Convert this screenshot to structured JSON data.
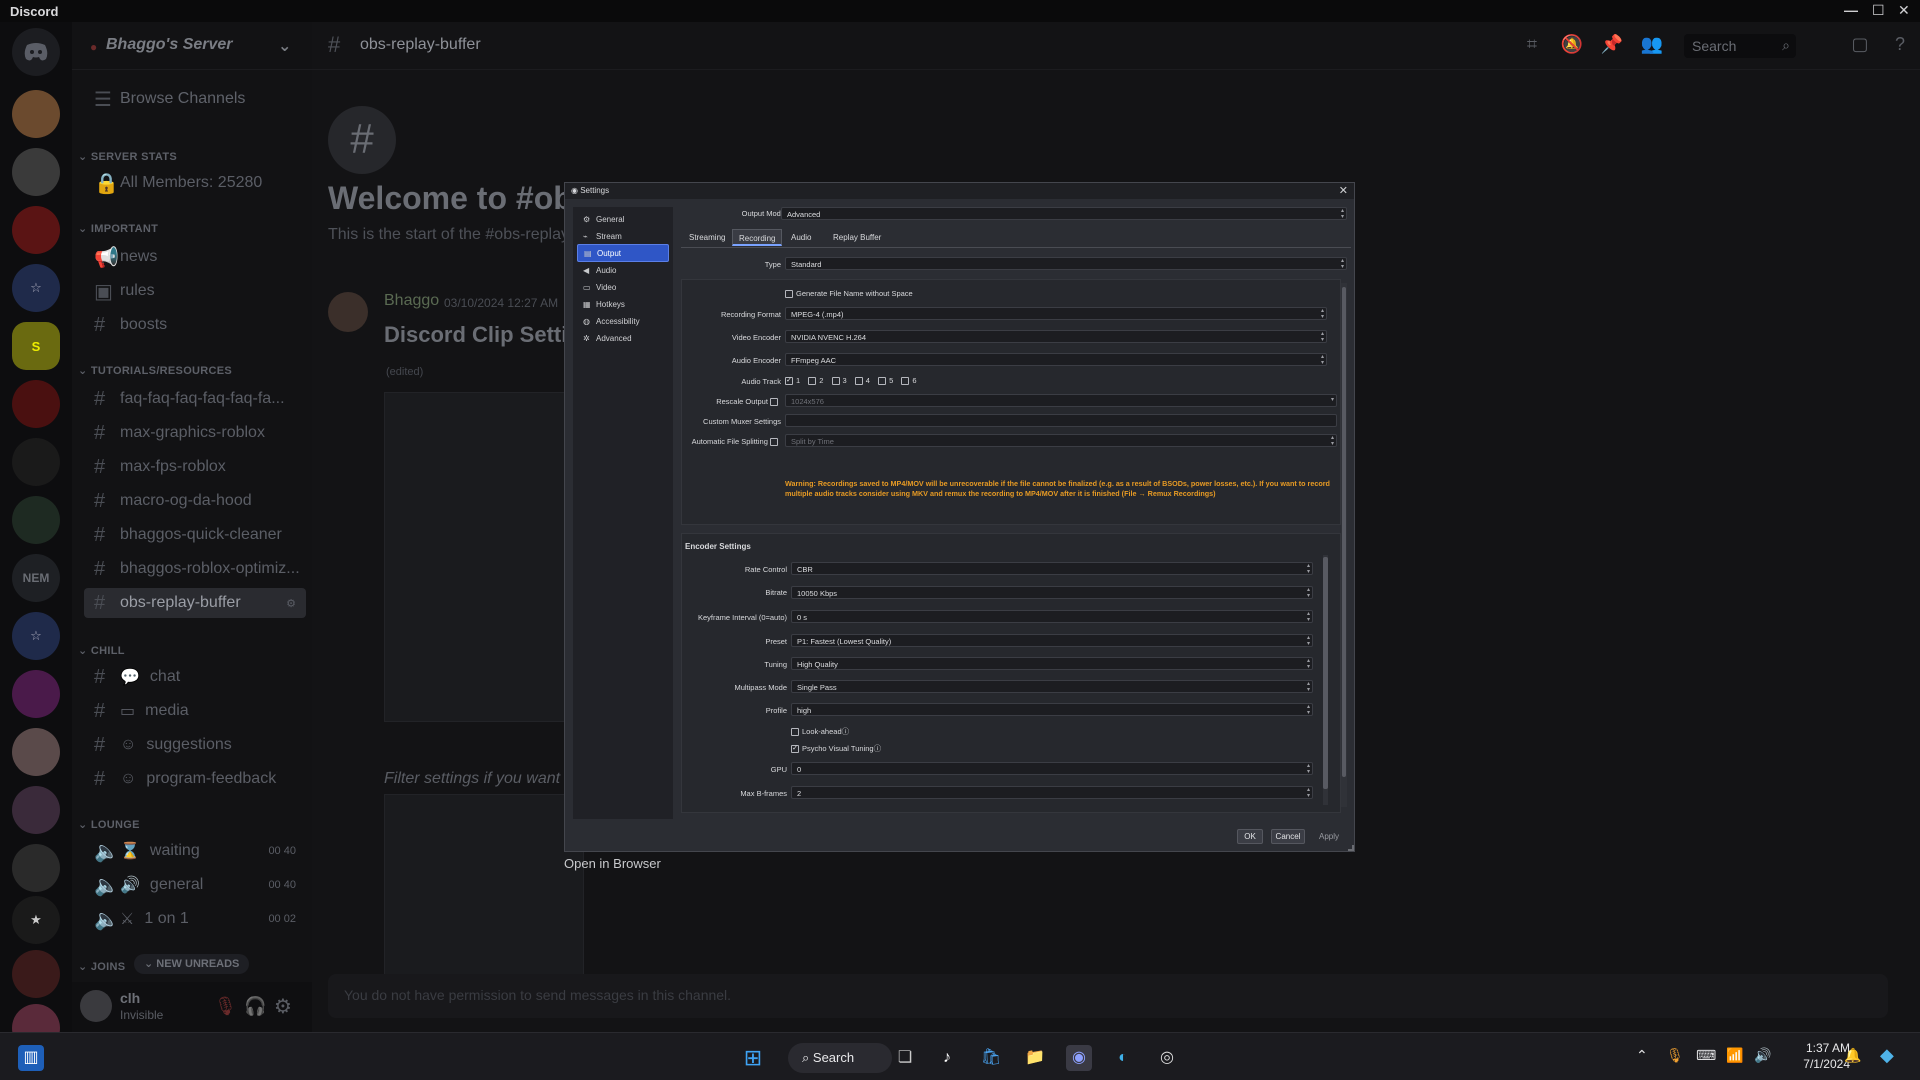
{
  "window": {
    "app_name": "Discord"
  },
  "server": {
    "name": "Bhaggo's Server",
    "browse_label": "Browse Channels"
  },
  "categories": {
    "server_stats": "SERVER STATS",
    "important": "IMPORTANT",
    "tutorials": "TUTORIALS/RESOURCES",
    "chill": "CHILL",
    "lounge": "LOUNGE",
    "joins": "JOINS"
  },
  "channels": {
    "all_members": "All Members: 25280",
    "news": "news",
    "rules": "rules",
    "boosts": "boosts",
    "faq": "faq-faq-faq-faq-faq-fa...",
    "max_graphics": "max-graphics-roblox",
    "max_fps": "max-fps-roblox",
    "macro": "macro-og-da-hood",
    "quick_cleaner": "bhaggos-quick-cleaner",
    "roblox_optimiz": "bhaggos-roblox-optimiz...",
    "obs_replay": "obs-replay-buffer",
    "chat": "chat",
    "media": "media",
    "suggestions": "suggestions",
    "program_feedback": "program-feedback",
    "waiting": "waiting",
    "waiting_cnt_a": "00",
    "waiting_cnt_b": "40",
    "general": "general",
    "general_cnt_a": "00",
    "general_cnt_b": "40",
    "one_on_one": "1 on 1",
    "one_cnt_a": "00",
    "one_cnt_b": "02",
    "new_unreads": "NEW UNREADS"
  },
  "user": {
    "name": "clh",
    "status": "Invisible"
  },
  "topbar": {
    "channel": "obs-replay-buffer",
    "search_placeholder": "Search"
  },
  "chat": {
    "welcome": "Welcome to #obs-",
    "start": "This is the start of the #obs-replay",
    "author": "Bhaggo",
    "timestamp": "03/10/2024 12:27 AM",
    "post_title": "Discord Clip Setti",
    "edited": "(edited)",
    "filter_caption": "Filter settings if you want",
    "open_browser": "Open in Browser",
    "no_permission": "You do not have permission to send messages in this channel."
  },
  "settings": {
    "title": "Settings",
    "nav": [
      {
        "label": "General",
        "icon": "gear-icon"
      },
      {
        "label": "Stream",
        "icon": "broadcast-icon"
      },
      {
        "label": "Output",
        "icon": "output-icon"
      },
      {
        "label": "Audio",
        "icon": "speaker-icon"
      },
      {
        "label": "Video",
        "icon": "monitor-icon"
      },
      {
        "label": "Hotkeys",
        "icon": "keyboard-icon"
      },
      {
        "label": "Accessibility",
        "icon": "accessibility-icon"
      },
      {
        "label": "Advanced",
        "icon": "tools-icon"
      }
    ],
    "output_mode_label": "Output Mode",
    "output_mode": "Advanced",
    "tabs": [
      "Streaming",
      "Recording",
      "Audio",
      "Replay Buffer"
    ],
    "type_label": "Type",
    "type_value": "Standard",
    "gen_filename": "Generate File Name without Space",
    "rec_format_label": "Recording Format",
    "rec_format": "MPEG-4 (.mp4)",
    "video_encoder_label": "Video Encoder",
    "video_encoder": "NVIDIA NVENC H.264",
    "audio_encoder_label": "Audio Encoder",
    "audio_encoder": "FFmpeg AAC",
    "audio_track_label": "Audio Track",
    "tracks": [
      "1",
      "2",
      "3",
      "4",
      "5",
      "6"
    ],
    "rescale_label": "Rescale Output",
    "rescale_value": "1024x576",
    "muxer_label": "Custom Muxer Settings",
    "split_label": "Automatic File Splitting",
    "split_value": "Split by Time",
    "warning": "Warning: Recordings saved to MP4/MOV will be unrecoverable if the file cannot be finalized (e.g. as a result of BSODs, power losses, etc.). If you want to record multiple audio tracks consider using MKV and remux the recording to MP4/MOV after it is finished (File → Remux Recordings)",
    "encoder_settings": "Encoder Settings",
    "rate_control_label": "Rate Control",
    "rate_control": "CBR",
    "bitrate_label": "Bitrate",
    "bitrate": "10050 Kbps",
    "keyframe_label": "Keyframe Interval (0=auto)",
    "keyframe": "0 s",
    "preset_label": "Preset",
    "preset": "P1: Fastest (Lowest Quality)",
    "tuning_label": "Tuning",
    "tuning": "High Quality",
    "multipass_label": "Multipass Mode",
    "multipass": "Single Pass",
    "profile_label": "Profile",
    "profile": "high",
    "lookahead": "Look-ahead",
    "psycho": "Psycho Visual Tuning",
    "gpu_label": "GPU",
    "gpu": "0",
    "bframes_label": "Max B-frames",
    "bframes": "2",
    "ok": "OK",
    "cancel": "Cancel",
    "apply": "Apply"
  },
  "taskbar": {
    "search": "Search",
    "time": "1:37 AM",
    "date": "7/1/2024"
  }
}
